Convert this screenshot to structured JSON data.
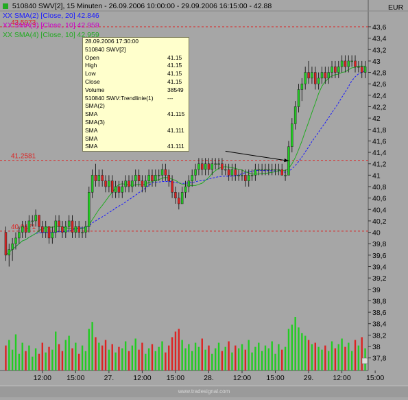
{
  "header": {
    "title": "510840  SWV[2], 15 Minuten - 26.09.2006 10:00:00 - 29.09.2006 16:15:00 - 42.88",
    "currency": "EUR",
    "indicators": [
      {
        "label": "XX SMA(2) [Close, 20] 42.846",
        "color": "#1a1aff"
      },
      {
        "label": "XX SMA(3) [Close, 10] 42.959",
        "color": "#cc00cc"
      },
      {
        "label": "XX SMA(4) [Close, 10] 42.959",
        "color": "#22aa22"
      }
    ]
  },
  "colors": {
    "background": "#a6a6a6",
    "up_candle": "#22cc22",
    "down_candle": "#dd2222",
    "reference_line": "#dd2222",
    "sma_blue": "#1a1aff",
    "sma_green": "#22aa22"
  },
  "tooltip": {
    "timestamp": "28.09.2006 17:30:00",
    "rows": [
      {
        "label": "510840  SWV[2]",
        "value": ""
      },
      {
        "label": "Open",
        "value": "41.15"
      },
      {
        "label": "High",
        "value": "41.15"
      },
      {
        "label": "Low",
        "value": "41.15"
      },
      {
        "label": "Close",
        "value": "41.15"
      },
      {
        "label": "Volume",
        "value": "38549"
      },
      {
        "label": "510840  SWV:Trendlinie(1)",
        "value": "---"
      },
      {
        "label": "SMA(2)",
        "value": ""
      },
      {
        "label": "SMA",
        "value": "41.115"
      },
      {
        "label": "SMA(3)",
        "value": ""
      },
      {
        "label": "SMA",
        "value": "41.111"
      },
      {
        "label": "SMA",
        "value": ""
      },
      {
        "label": "SMA",
        "value": "41.111"
      }
    ]
  },
  "footer": {
    "text": "www.tradesignal.com"
  },
  "chart_data": {
    "type": "candlestick",
    "y_axis_position": "right",
    "ylim": [
      37.7,
      43.9
    ],
    "yticks": [
      "43,6",
      "43,4",
      "43,2",
      "43",
      "42,8",
      "42,6",
      "42,4",
      "42,2",
      "42",
      "41,8",
      "41,6",
      "41,4",
      "41,2",
      "41",
      "40,8",
      "40,6",
      "40,4",
      "40,2",
      "40",
      "39,8",
      "39,6",
      "39,4",
      "39,2",
      "39",
      "38,8",
      "38,6",
      "38,4",
      "38,2",
      "38",
      "37,8"
    ],
    "ytick_values": [
      43.6,
      43.4,
      43.2,
      43.0,
      42.8,
      42.6,
      42.4,
      42.2,
      42.0,
      41.8,
      41.6,
      41.4,
      41.2,
      41.0,
      40.8,
      40.6,
      40.4,
      40.2,
      40.0,
      39.8,
      39.6,
      39.4,
      39.2,
      39.0,
      38.8,
      38.6,
      38.4,
      38.2,
      38.0,
      37.8
    ],
    "xticks": [
      {
        "index": 11,
        "label": "12:00"
      },
      {
        "index": 21,
        "label": "15:00"
      },
      {
        "index": 31,
        "label": "27."
      },
      {
        "index": 41,
        "label": "12:00"
      },
      {
        "index": 51,
        "label": "15:00"
      },
      {
        "index": 61,
        "label": "28."
      },
      {
        "index": 71,
        "label": "12:00"
      },
      {
        "index": 81,
        "label": "15:00"
      },
      {
        "index": 91,
        "label": "29."
      },
      {
        "index": 101,
        "label": "12:00"
      },
      {
        "index": 111,
        "label": "15:00"
      }
    ],
    "reference_lines": [
      {
        "value": 43.6,
        "label": "43.5973"
      },
      {
        "value": 41.26,
        "label": "41.2581"
      },
      {
        "value": 40.02,
        "label": "40.0171"
      }
    ],
    "trendline": {
      "from": [
        66,
        41.42
      ],
      "to": [
        85,
        41.25
      ],
      "arrow": true
    },
    "volume_max": 38549,
    "bars": [
      [
        40.0,
        40.1,
        39.5,
        39.6,
        18000
      ],
      [
        39.6,
        39.8,
        39.4,
        39.7,
        22000
      ],
      [
        39.7,
        39.9,
        39.5,
        39.8,
        15000
      ],
      [
        39.8,
        40.0,
        39.7,
        39.9,
        26000
      ],
      [
        39.9,
        40.1,
        39.8,
        40.0,
        12000
      ],
      [
        40.0,
        40.2,
        39.9,
        40.1,
        20000
      ],
      [
        40.1,
        40.2,
        39.9,
        40.0,
        14000
      ],
      [
        40.0,
        40.3,
        40.0,
        40.2,
        18000
      ],
      [
        40.2,
        40.3,
        40.1,
        40.2,
        10000
      ],
      [
        40.2,
        40.4,
        40.1,
        40.3,
        16000
      ],
      [
        40.3,
        40.3,
        40.0,
        40.1,
        12000
      ],
      [
        40.1,
        40.2,
        39.9,
        40.0,
        20000
      ],
      [
        40.0,
        40.2,
        39.9,
        40.1,
        13000
      ],
      [
        40.1,
        40.1,
        39.8,
        39.9,
        17000
      ],
      [
        39.9,
        40.1,
        39.8,
        40.0,
        15000
      ],
      [
        40.0,
        40.3,
        39.9,
        40.2,
        28000
      ],
      [
        40.2,
        40.3,
        40.0,
        40.1,
        19000
      ],
      [
        40.1,
        40.2,
        39.9,
        40.0,
        14000
      ],
      [
        40.0,
        40.2,
        39.9,
        40.1,
        22000
      ],
      [
        40.1,
        40.3,
        40.0,
        40.2,
        25000
      ],
      [
        40.2,
        40.3,
        39.9,
        40.0,
        16000
      ],
      [
        40.0,
        40.2,
        39.9,
        40.1,
        20000
      ],
      [
        40.1,
        40.2,
        39.9,
        40.0,
        12000
      ],
      [
        40.0,
        40.1,
        39.9,
        40.0,
        18000
      ],
      [
        40.0,
        40.2,
        39.9,
        40.1,
        14000
      ],
      [
        40.1,
        40.8,
        40.0,
        40.7,
        30000
      ],
      [
        40.7,
        41.1,
        40.6,
        41.0,
        35000
      ],
      [
        41.0,
        41.2,
        40.8,
        40.9,
        24000
      ],
      [
        40.9,
        41.1,
        40.8,
        41.0,
        20000
      ],
      [
        41.0,
        41.1,
        40.8,
        40.9,
        18000
      ],
      [
        40.9,
        41.0,
        40.7,
        40.8,
        22000
      ],
      [
        40.8,
        41.0,
        40.7,
        40.9,
        15000
      ],
      [
        40.9,
        41.0,
        40.6,
        40.7,
        19000
      ],
      [
        40.7,
        40.9,
        40.6,
        40.8,
        13000
      ],
      [
        40.8,
        40.9,
        40.6,
        40.7,
        17000
      ],
      [
        40.7,
        40.9,
        40.6,
        40.8,
        16000
      ],
      [
        40.8,
        41.0,
        40.7,
        40.9,
        21000
      ],
      [
        40.9,
        41.0,
        40.7,
        40.8,
        14000
      ],
      [
        40.8,
        41.0,
        40.7,
        40.9,
        18000
      ],
      [
        40.9,
        41.1,
        40.8,
        41.0,
        23000
      ],
      [
        41.0,
        41.1,
        40.8,
        40.9,
        15000
      ],
      [
        40.9,
        41.0,
        40.7,
        40.8,
        20000
      ],
      [
        40.8,
        41.0,
        40.7,
        40.9,
        12000
      ],
      [
        40.9,
        41.1,
        40.8,
        41.0,
        16000
      ],
      [
        41.0,
        41.1,
        40.8,
        40.9,
        19000
      ],
      [
        40.9,
        41.1,
        40.8,
        41.0,
        14000
      ],
      [
        41.0,
        41.1,
        40.9,
        41.0,
        17000
      ],
      [
        41.0,
        41.2,
        40.9,
        41.1,
        21000
      ],
      [
        41.1,
        41.2,
        40.9,
        41.0,
        13000
      ],
      [
        41.0,
        41.1,
        40.8,
        40.9,
        18000
      ],
      [
        40.9,
        41.0,
        40.6,
        40.7,
        24000
      ],
      [
        40.7,
        40.8,
        40.5,
        40.6,
        28000
      ],
      [
        40.6,
        40.7,
        40.4,
        40.5,
        30000
      ],
      [
        40.5,
        40.8,
        40.5,
        40.7,
        22000
      ],
      [
        40.7,
        40.9,
        40.6,
        40.8,
        16000
      ],
      [
        40.8,
        41.0,
        40.7,
        40.9,
        19000
      ],
      [
        40.9,
        41.1,
        40.8,
        41.0,
        14000
      ],
      [
        41.0,
        41.2,
        40.9,
        41.1,
        20000
      ],
      [
        41.1,
        41.3,
        41.0,
        41.2,
        17000
      ],
      [
        41.2,
        41.3,
        41.0,
        41.1,
        23000
      ],
      [
        41.1,
        41.3,
        41.0,
        41.2,
        15000
      ],
      [
        41.2,
        41.3,
        41.0,
        41.1,
        18000
      ],
      [
        41.1,
        41.3,
        41.0,
        41.2,
        12000
      ],
      [
        41.2,
        41.3,
        41.1,
        41.2,
        16000
      ],
      [
        41.2,
        41.3,
        41.1,
        41.2,
        20000
      ],
      [
        41.2,
        41.3,
        41.0,
        41.1,
        14000
      ],
      [
        41.1,
        41.2,
        41.0,
        41.1,
        17000
      ],
      [
        41.1,
        41.2,
        40.9,
        41.0,
        21000
      ],
      [
        41.0,
        41.2,
        40.9,
        41.1,
        13000
      ],
      [
        41.1,
        41.2,
        40.9,
        41.0,
        18000
      ],
      [
        41.0,
        41.1,
        40.9,
        41.0,
        16000
      ],
      [
        41.0,
        41.1,
        40.9,
        41.0,
        19000
      ],
      [
        41.0,
        41.1,
        40.8,
        40.9,
        15000
      ],
      [
        40.9,
        41.1,
        40.8,
        41.0,
        22000
      ],
      [
        41.0,
        41.1,
        40.9,
        41.0,
        13000
      ],
      [
        41.0,
        41.2,
        40.9,
        41.1,
        17000
      ],
      [
        41.1,
        41.2,
        41.0,
        41.1,
        20000
      ],
      [
        41.1,
        41.2,
        41.0,
        41.1,
        14000
      ],
      [
        41.1,
        41.2,
        41.0,
        41.1,
        18000
      ],
      [
        41.1,
        41.2,
        41.0,
        41.1,
        16000
      ],
      [
        41.1,
        41.2,
        41.0,
        41.1,
        21000
      ],
      [
        41.1,
        41.2,
        41.0,
        41.1,
        12000
      ],
      [
        41.1,
        41.2,
        41.0,
        41.1,
        19000
      ],
      [
        41.1,
        41.2,
        41.0,
        41.0,
        15000
      ],
      [
        41.0,
        41.1,
        40.9,
        41.0,
        17000
      ],
      [
        41.0,
        41.6,
        41.0,
        41.5,
        30000
      ],
      [
        41.5,
        42.0,
        41.4,
        41.9,
        33000
      ],
      [
        41.9,
        42.3,
        41.8,
        42.2,
        38549
      ],
      [
        42.2,
        42.6,
        42.1,
        42.5,
        31000
      ],
      [
        42.5,
        42.7,
        42.3,
        42.6,
        27000
      ],
      [
        42.6,
        42.9,
        42.5,
        42.8,
        25000
      ],
      [
        42.8,
        43.0,
        42.6,
        42.7,
        22000
      ],
      [
        42.7,
        42.9,
        42.6,
        42.8,
        19000
      ],
      [
        42.8,
        42.9,
        42.5,
        42.6,
        20000
      ],
      [
        42.6,
        42.8,
        42.5,
        42.7,
        17000
      ],
      [
        42.7,
        42.9,
        42.6,
        42.8,
        15000
      ],
      [
        42.8,
        42.9,
        42.6,
        42.7,
        18000
      ],
      [
        42.7,
        42.9,
        42.6,
        42.8,
        14000
      ],
      [
        42.8,
        43.0,
        42.7,
        42.9,
        21000
      ],
      [
        42.9,
        43.0,
        42.7,
        42.8,
        16000
      ],
      [
        42.8,
        43.0,
        42.7,
        42.9,
        19000
      ],
      [
        42.9,
        43.1,
        42.8,
        43.0,
        23000
      ],
      [
        43.0,
        43.1,
        42.8,
        42.9,
        17000
      ],
      [
        42.9,
        43.1,
        42.8,
        43.0,
        20000
      ],
      [
        43.0,
        43.1,
        42.9,
        43.0,
        14000
      ],
      [
        43.0,
        43.1,
        42.8,
        42.9,
        22000
      ],
      [
        42.9,
        43.0,
        42.8,
        42.9,
        18000
      ],
      [
        42.9,
        43.0,
        42.7,
        42.8,
        24000
      ],
      [
        42.8,
        43.0,
        42.7,
        42.9,
        16000
      ]
    ]
  }
}
